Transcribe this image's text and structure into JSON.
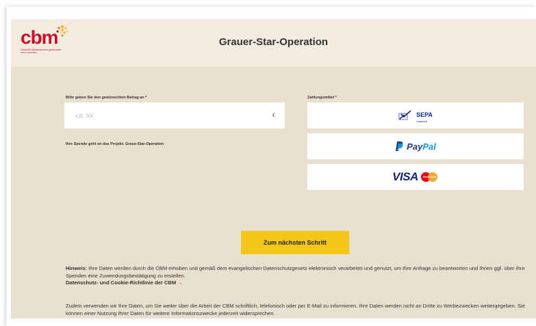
{
  "header": {
    "logo_text": "cbm",
    "logo_tagline": "Christoffel-Blindenmission gemeinsam mehr erreichen",
    "title": "Grauer-Star-Operation"
  },
  "form": {
    "amount_label": "Bitte geben Sie den gewünschten Betrag an *",
    "amount_placeholder": "z.B. 50€",
    "currency": "€",
    "project_note": "Ihre Spende geht an das Projekt: Graue-Star-Operation",
    "payment_label": "Zahlungsmittel *",
    "payment_methods": [
      {
        "name": "SEPA",
        "sub": "Lastschrift"
      },
      {
        "name_part1": "Pay",
        "name_part2": "Pal"
      },
      {
        "name": "VISA",
        "extra": "MasterCard"
      }
    ],
    "next_button": "Zum nächsten Schritt"
  },
  "notice": {
    "prefix": "Hinweis:",
    "text": " Ihre Daten werden durch die CBM erhoben und gemäß dem evangelischen Datenschutzgesetz elektronisch verarbeitet und genutzt, um Ihre Anfrage zu beantworten und Ihnen ggf. über Ihre Spenden eine Zuwendungsbestätigung zu erstellen.",
    "link": "Datenschutz- und Cookie-Richtlinie der CBM",
    "link_arrow": "→",
    "text2": "Zudem verwenden wir Ihre Daten, um Sie weiter über die Arbeit der CBM schriftlich, telefonisch oder per E-Mail zu informieren. Ihre Daten werden nicht an Dritte zu Werbezwecken weitergegeben. Sie können einer Nutzung Ihrer Daten für weitere Informationszwecke jederzeit widersprechen."
  },
  "colors": {
    "brand_red": "#c8102e",
    "header_bg": "#f1ebe0",
    "form_bg": "#e8dfcf",
    "button_yellow": "#f5c518"
  }
}
